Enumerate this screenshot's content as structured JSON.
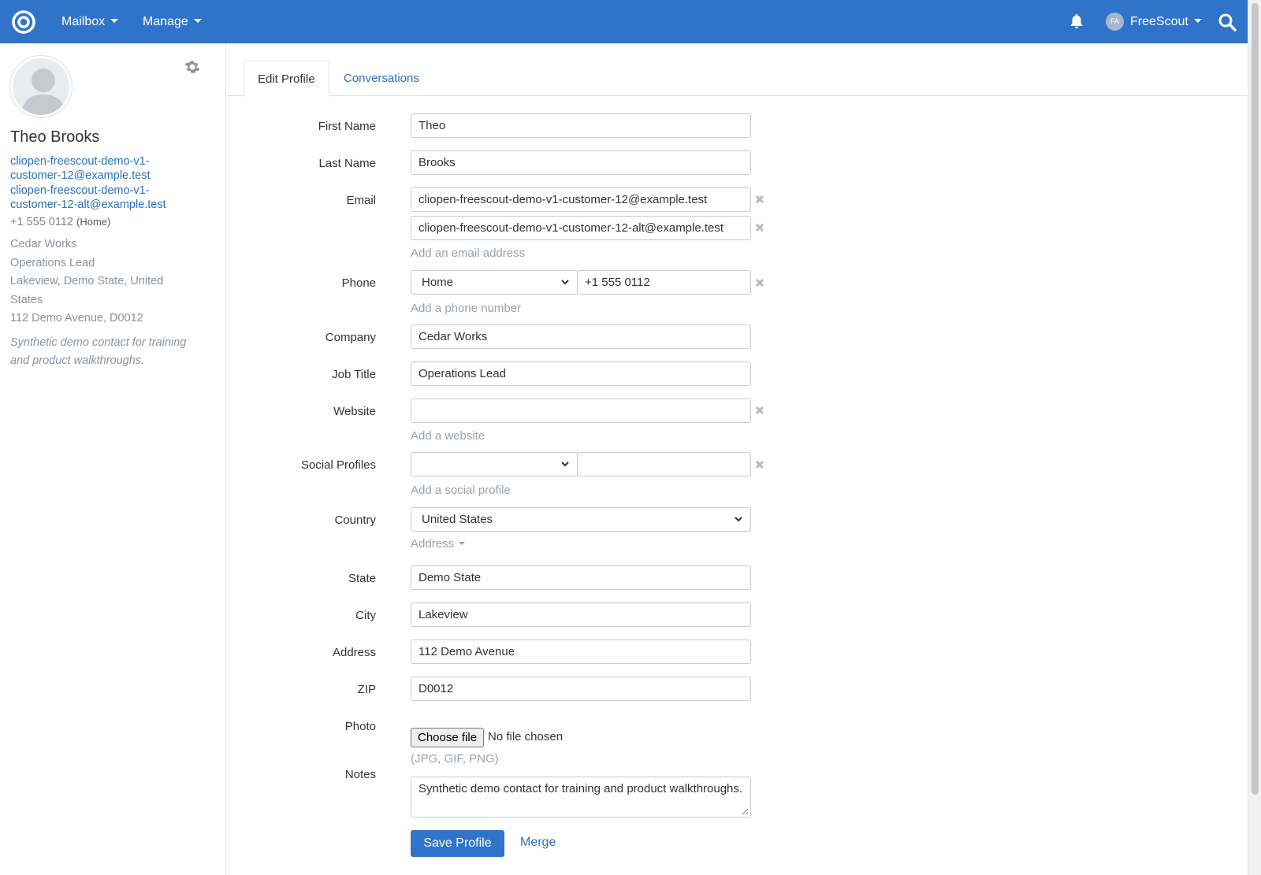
{
  "nav": {
    "logo": "freescout-logo-icon",
    "mailbox": "Mailbox",
    "manage": "Manage",
    "avatar_initials": "FA",
    "user": "FreeScout",
    "icons": [
      "bell-icon",
      "search-icon"
    ]
  },
  "sidebar": {
    "name": "Theo Brooks",
    "emails": [
      "cliopen-freescout-demo-v1-customer-12@example.test",
      "cliopen-freescout-demo-v1-customer-12-alt@example.test"
    ],
    "phone": "+1 555 0112",
    "phone_type": "(Home)",
    "company": "Cedar Works",
    "job_title": "Operations Lead",
    "location": "Lakeview, Demo State, United States",
    "address": "112 Demo Avenue, D0012",
    "note": "Synthetic demo contact for training and product walkthroughs."
  },
  "tabs": {
    "edit_profile": "Edit Profile",
    "conversations": "Conversations"
  },
  "form": {
    "labels": {
      "first_name": "First Name",
      "last_name": "Last Name",
      "email": "Email",
      "phone": "Phone",
      "company": "Company",
      "job_title": "Job Title",
      "website": "Website",
      "social_profiles": "Social Profiles",
      "country": "Country",
      "state": "State",
      "city": "City",
      "address": "Address",
      "zip": "ZIP",
      "photo": "Photo",
      "notes": "Notes"
    },
    "values": {
      "first_name": "Theo",
      "last_name": "Brooks",
      "email_1": "cliopen-freescout-demo-v1-customer-12@example.test",
      "email_2": "cliopen-freescout-demo-v1-customer-12-alt@example.test",
      "phone_type": "Home",
      "phone": "+1 555 0112",
      "company": "Cedar Works",
      "job_title": "Operations Lead",
      "website": "",
      "social_type": "",
      "social_value": "",
      "country": "United States",
      "state": "Demo State",
      "city": "Lakeview",
      "address": "112 Demo Avenue",
      "zip": "D0012",
      "notes": "Synthetic demo contact for training and product walkthroughs."
    },
    "helpers": {
      "add_email": "Add an email address",
      "add_phone": "Add a phone number",
      "add_website": "Add a website",
      "add_social": "Add a social profile",
      "address_toggle": "Address",
      "photo_hint": "(JPG, GIF, PNG)"
    },
    "photo": {
      "button": "Choose file",
      "status": "No file chosen"
    },
    "save": "Save Profile",
    "merge": "Merge"
  }
}
